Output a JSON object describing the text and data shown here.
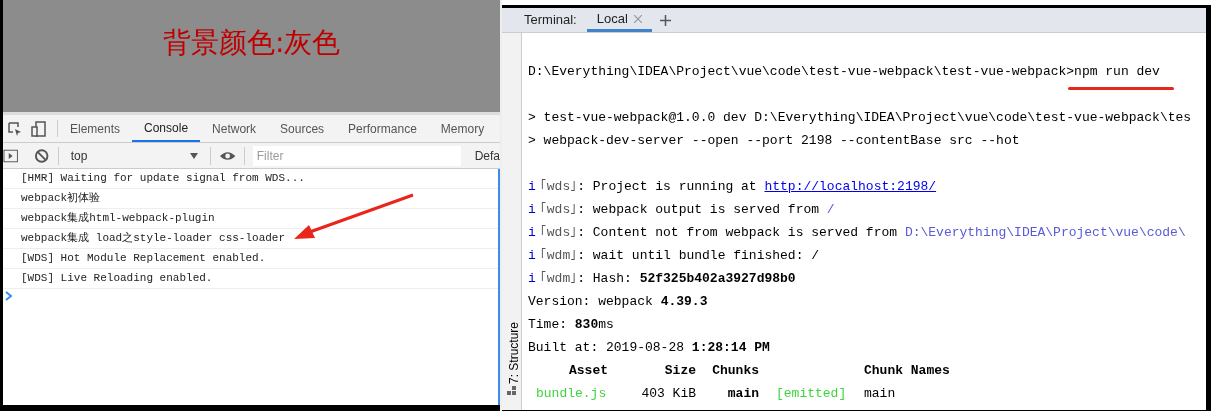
{
  "page": {
    "heading": "背景颜色:灰色"
  },
  "devtools": {
    "tabs": [
      {
        "label": "Elements",
        "selected": false
      },
      {
        "label": "Console",
        "selected": true
      },
      {
        "label": "Network",
        "selected": false
      },
      {
        "label": "Sources",
        "selected": false
      },
      {
        "label": "Performance",
        "selected": false
      },
      {
        "label": "Memory",
        "selected": false
      }
    ],
    "context": "top",
    "filter_placeholder": "Filter",
    "levels": "Defa",
    "console_lines": [
      {
        "text": "[HMR] Waiting for update signal from WDS...",
        "arrow": false
      },
      {
        "text": "webpack初体验",
        "arrow": false
      },
      {
        "text": "webpack集成html-webpack-plugin",
        "arrow": false
      },
      {
        "text": "webpack集成 load之style-loader css-loader",
        "arrow": true
      },
      {
        "text": "[WDS] Hot Module Replacement enabled.",
        "arrow": false
      },
      {
        "text": "[WDS] Live Reloading enabled.",
        "arrow": false
      }
    ]
  },
  "terminal": {
    "label": "Terminal:",
    "tabs": [
      {
        "label": "Local",
        "selected": true
      }
    ],
    "sidebar_label": "7: Structure",
    "lines": [
      {
        "kind": "text",
        "segments": [
          {
            "text": "D:\\Everything\\IDEA\\Project\\vue\\code\\test-vue-webpack\\test-vue-webpack>",
            "kind": "plain",
            "underlined": false
          },
          {
            "text": "npm run dev",
            "kind": "plain",
            "underlined": true
          }
        ]
      },
      {
        "kind": "blank"
      },
      {
        "kind": "text",
        "segments": [
          {
            "text": "> test-vue-webpack@1.0.0 dev D:\\Everything\\IDEA\\Project\\vue\\code\\test-vue-webpack\\tes",
            "kind": "plain"
          }
        ]
      },
      {
        "kind": "text",
        "segments": [
          {
            "text": "> webpack-dev-server --open --port 2198 --contentBase src --hot",
            "kind": "plain"
          }
        ]
      },
      {
        "kind": "blank"
      },
      {
        "kind": "text",
        "segments": [
          {
            "text": "i",
            "kind": "info"
          },
          {
            "text": "｢wds｣",
            "kind": "tag"
          },
          {
            "text": ": Project is running at ",
            "kind": "plain"
          },
          {
            "text": "http://localhost:2198/",
            "kind": "link"
          }
        ]
      },
      {
        "kind": "text",
        "segments": [
          {
            "text": "i",
            "kind": "info"
          },
          {
            "text": "｢wds｣",
            "kind": "tag"
          },
          {
            "text": ": webpack output is served from ",
            "kind": "plain"
          },
          {
            "text": "/",
            "kind": "path"
          }
        ]
      },
      {
        "kind": "text",
        "segments": [
          {
            "text": "i",
            "kind": "info"
          },
          {
            "text": "｢wds｣",
            "kind": "tag"
          },
          {
            "text": ": Content not from webpack is served from ",
            "kind": "plain"
          },
          {
            "text": "D:\\Everything\\IDEA\\Project\\vue\\code\\",
            "kind": "path"
          }
        ]
      },
      {
        "kind": "text",
        "segments": [
          {
            "text": "i",
            "kind": "info"
          },
          {
            "text": "｢wdm｣",
            "kind": "tag"
          },
          {
            "text": ": wait until bundle finished: /",
            "kind": "plain"
          }
        ]
      },
      {
        "kind": "text",
        "segments": [
          {
            "text": "i",
            "kind": "info"
          },
          {
            "text": "｢wdm｣",
            "kind": "tag"
          },
          {
            "text": ": Hash: ",
            "kind": "plain"
          },
          {
            "text": "52f325b402a3927d98b0",
            "kind": "bold"
          }
        ]
      },
      {
        "kind": "text",
        "segments": [
          {
            "text": "Version: webpack ",
            "kind": "plain"
          },
          {
            "text": "4.39.3",
            "kind": "bold"
          }
        ]
      },
      {
        "kind": "text",
        "segments": [
          {
            "text": "Time: ",
            "kind": "plain"
          },
          {
            "text": "830",
            "kind": "bold"
          },
          {
            "text": "ms",
            "kind": "plain"
          }
        ]
      },
      {
        "kind": "text",
        "segments": [
          {
            "text": "Built at: 2019-08-28 ",
            "kind": "plain"
          },
          {
            "text": "1:28:14 PM",
            "kind": "bold"
          }
        ]
      }
    ],
    "table": {
      "columns": [
        "Asset",
        "Size",
        "Chunks",
        "",
        "Chunk Names"
      ],
      "rows": [
        [
          {
            "text": "bundle.js",
            "kind": "green"
          },
          {
            "text": "403 KiB",
            "kind": "plain"
          },
          {
            "text": "main",
            "kind": "bold"
          },
          {
            "text": "[emitted]",
            "kind": "green"
          },
          {
            "text": "main",
            "kind": "plain"
          }
        ]
      ]
    }
  }
}
